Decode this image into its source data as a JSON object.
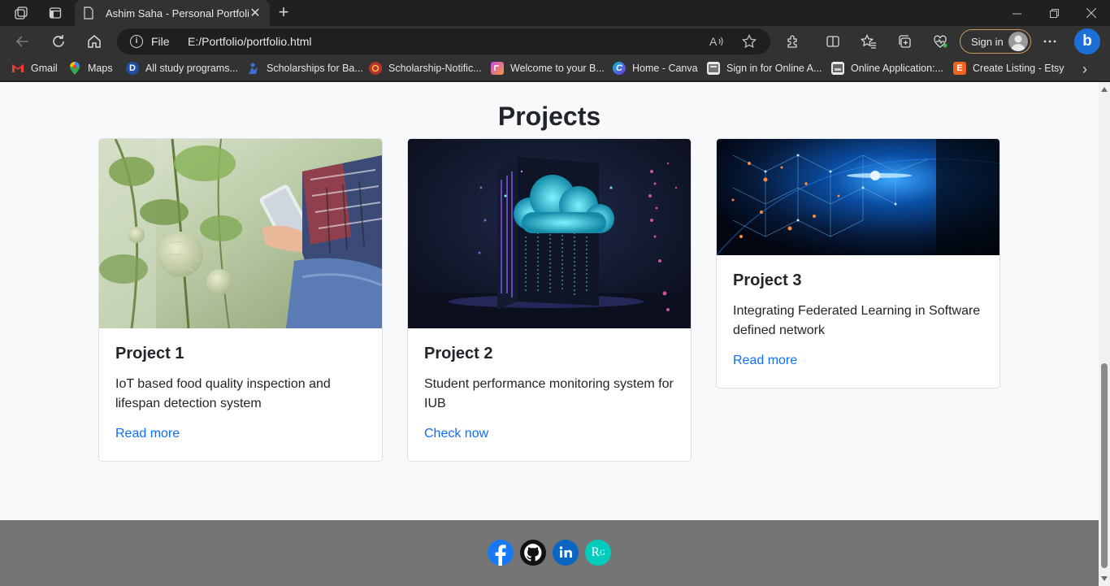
{
  "browser": {
    "tab_title": "Ashim Saha - Personal Portfolio",
    "address_prefix": "File",
    "url": "E:/Portfolio/portfolio.html",
    "signin_label": "Sign in",
    "bookmarks": [
      {
        "label": "Gmail",
        "icon": "gmail-icon"
      },
      {
        "label": "Maps",
        "icon": "maps-icon"
      },
      {
        "label": "All study programs...",
        "icon": "d-icon"
      },
      {
        "label": "Scholarships for Ba...",
        "icon": "scholar-icon"
      },
      {
        "label": "Scholarship-Notific...",
        "icon": "notific-icon"
      },
      {
        "label": "Welcome to your B...",
        "icon": "welcome-icon"
      },
      {
        "label": "Home - Canva",
        "icon": "canva-icon"
      },
      {
        "label": "Sign in for Online A...",
        "icon": "signin-page-icon"
      },
      {
        "label": "Online Application:...",
        "icon": "application-icon"
      },
      {
        "label": "Create Listing - Etsy",
        "icon": "etsy-icon"
      }
    ]
  },
  "projects": {
    "heading": "Projects",
    "cards": [
      {
        "title": "Project 1",
        "description": "IoT based food quality inspection and lifespan detection system",
        "link": "Read more"
      },
      {
        "title": "Project 2",
        "description": "Student performance monitoring system for IUB",
        "link": "Check now"
      },
      {
        "title": "Project 3",
        "description": "Integrating Federated Learning in Software defined network",
        "link": "Read more"
      }
    ]
  },
  "footer": {
    "social": [
      {
        "name": "facebook-icon",
        "color": "#1877f2"
      },
      {
        "name": "github-icon",
        "color": "#111111"
      },
      {
        "name": "linkedin-icon",
        "color": "#0a66c2"
      },
      {
        "name": "researchgate-icon",
        "color": "#00ccbb"
      }
    ],
    "researchgate_glyph": "R",
    "researchgate_sup": "G"
  },
  "colors": {
    "link": "#0d6efd",
    "footer_bg": "#757575",
    "page_bg": "#f8f9fa"
  }
}
